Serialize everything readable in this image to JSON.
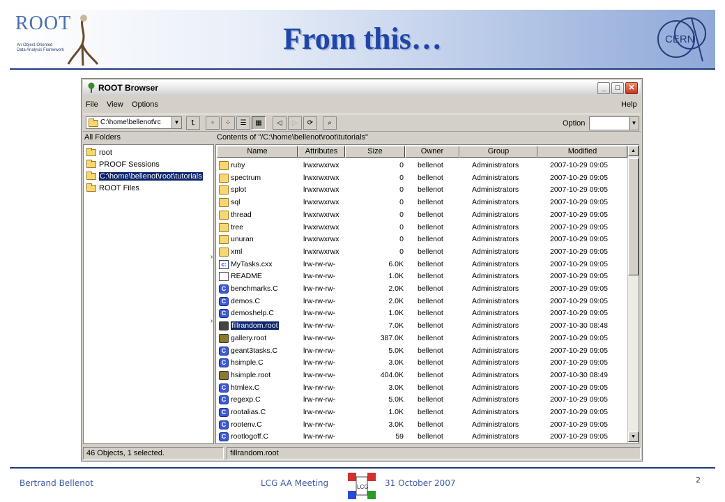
{
  "slide": {
    "title": "From this…",
    "root_logo_word": "ROOT",
    "root_logo_sub": "An Object-Oriented\nData Analysis Framework",
    "cern_logo": "CERN",
    "footer_author": "Bertrand Bellenot",
    "footer_meeting": "LCG AA Meeting",
    "footer_lcg": "LCG",
    "footer_date": "31 October 2007",
    "page_number": "2"
  },
  "window": {
    "title": "ROOT Browser",
    "menus": [
      "File",
      "View",
      "Options",
      "Help"
    ],
    "path_combo": "C:\\home\\bellenot\\rc",
    "option_label": "Option",
    "left_header": "All Folders",
    "right_header": "Contents of \"/C:\\home\\bellenot\\root\\tutorials\"",
    "tree": [
      {
        "label": "root",
        "selected": false
      },
      {
        "label": "PROOF Sessions",
        "selected": false
      },
      {
        "label": "C:\\home\\bellenot\\root\\tutorials",
        "selected": true
      },
      {
        "label": "ROOT Files",
        "selected": false
      }
    ],
    "columns": [
      "Name",
      "Attributes",
      "Size",
      "Owner",
      "Group",
      "Modified"
    ],
    "rows": [
      {
        "icon": "folder",
        "name": "ruby",
        "attr": "lrwxrwxrwx",
        "size": "0",
        "owner": "bellenot",
        "group": "Administrators",
        "modified": "2007-10-29 09:05"
      },
      {
        "icon": "folder",
        "name": "spectrum",
        "attr": "lrwxrwxrwx",
        "size": "0",
        "owner": "bellenot",
        "group": "Administrators",
        "modified": "2007-10-29 09:05"
      },
      {
        "icon": "folder",
        "name": "splot",
        "attr": "lrwxrwxrwx",
        "size": "0",
        "owner": "bellenot",
        "group": "Administrators",
        "modified": "2007-10-29 09:05"
      },
      {
        "icon": "folder",
        "name": "sql",
        "attr": "lrwxrwxrwx",
        "size": "0",
        "owner": "bellenot",
        "group": "Administrators",
        "modified": "2007-10-29 09:05"
      },
      {
        "icon": "folder",
        "name": "thread",
        "attr": "lrwxrwxrwx",
        "size": "0",
        "owner": "bellenot",
        "group": "Administrators",
        "modified": "2007-10-29 09:05"
      },
      {
        "icon": "folder",
        "name": "tree",
        "attr": "lrwxrwxrwx",
        "size": "0",
        "owner": "bellenot",
        "group": "Administrators",
        "modified": "2007-10-29 09:05"
      },
      {
        "icon": "folder",
        "name": "unuran",
        "attr": "lrwxrwxrwx",
        "size": "0",
        "owner": "bellenot",
        "group": "Administrators",
        "modified": "2007-10-29 09:05"
      },
      {
        "icon": "folder",
        "name": "xml",
        "attr": "lrwxrwxrwx",
        "size": "0",
        "owner": "bellenot",
        "group": "Administrators",
        "modified": "2007-10-29 09:05"
      },
      {
        "icon": "cfile",
        "name": "MyTasks.cxx",
        "attr": "lrw-rw-rw-",
        "size": "6.0K",
        "owner": "bellenot",
        "group": "Administrators",
        "modified": "2007-10-29 09:05"
      },
      {
        "icon": "doc",
        "name": "README",
        "attr": "lrw-rw-rw-",
        "size": "1.0K",
        "owner": "bellenot",
        "group": "Administrators",
        "modified": "2007-10-29 09:05"
      },
      {
        "icon": "cplus",
        "name": "benchmarks.C",
        "attr": "lrw-rw-rw-",
        "size": "2.0K",
        "owner": "bellenot",
        "group": "Administrators",
        "modified": "2007-10-29 09:05"
      },
      {
        "icon": "cplus",
        "name": "demos.C",
        "attr": "lrw-rw-rw-",
        "size": "2.0K",
        "owner": "bellenot",
        "group": "Administrators",
        "modified": "2007-10-29 09:05"
      },
      {
        "icon": "cplus",
        "name": "demoshelp.C",
        "attr": "lrw-rw-rw-",
        "size": "1.0K",
        "owner": "bellenot",
        "group": "Administrators",
        "modified": "2007-10-29 09:05"
      },
      {
        "icon": "rootfile-dark",
        "name": "fillrandom.root",
        "attr": "lrw-rw-rw-",
        "size": "7.0K",
        "owner": "bellenot",
        "group": "Administrators",
        "modified": "2007-10-30 08:48",
        "selected": true
      },
      {
        "icon": "rootfile",
        "name": "gallery.root",
        "attr": "lrw-rw-rw-",
        "size": "387.0K",
        "owner": "bellenot",
        "group": "Administrators",
        "modified": "2007-10-29 09:05"
      },
      {
        "icon": "cplus",
        "name": "geant3tasks.C",
        "attr": "lrw-rw-rw-",
        "size": "5.0K",
        "owner": "bellenot",
        "group": "Administrators",
        "modified": "2007-10-29 09:05"
      },
      {
        "icon": "cplus",
        "name": "hsimple.C",
        "attr": "lrw-rw-rw-",
        "size": "3.0K",
        "owner": "bellenot",
        "group": "Administrators",
        "modified": "2007-10-29 09:05"
      },
      {
        "icon": "rootfile",
        "name": "hsimple.root",
        "attr": "lrw-rw-rw-",
        "size": "404.0K",
        "owner": "bellenot",
        "group": "Administrators",
        "modified": "2007-10-30 08:49"
      },
      {
        "icon": "cplus",
        "name": "htmlex.C",
        "attr": "lrw-rw-rw-",
        "size": "3.0K",
        "owner": "bellenot",
        "group": "Administrators",
        "modified": "2007-10-29 09:05"
      },
      {
        "icon": "cplus",
        "name": "regexp.C",
        "attr": "lrw-rw-rw-",
        "size": "5.0K",
        "owner": "bellenot",
        "group": "Administrators",
        "modified": "2007-10-29 09:05"
      },
      {
        "icon": "cplus",
        "name": "rootalias.C",
        "attr": "lrw-rw-rw-",
        "size": "1.0K",
        "owner": "bellenot",
        "group": "Administrators",
        "modified": "2007-10-29 09:05"
      },
      {
        "icon": "cplus",
        "name": "rootenv.C",
        "attr": "lrw-rw-rw-",
        "size": "3.0K",
        "owner": "bellenot",
        "group": "Administrators",
        "modified": "2007-10-29 09:05"
      },
      {
        "icon": "cplus",
        "name": "rootlogoff.C",
        "attr": "lrw-rw-rw-",
        "size": "59",
        "owner": "bellenot",
        "group": "Administrators",
        "modified": "2007-10-29 09:05"
      }
    ],
    "status_count": "46 Objects, 1 selected.",
    "status_selected": "fillrandom.root"
  },
  "colors": {
    "title": "#2045a6",
    "selection": "#0a246a",
    "footer_text": "#3a5aa8"
  }
}
